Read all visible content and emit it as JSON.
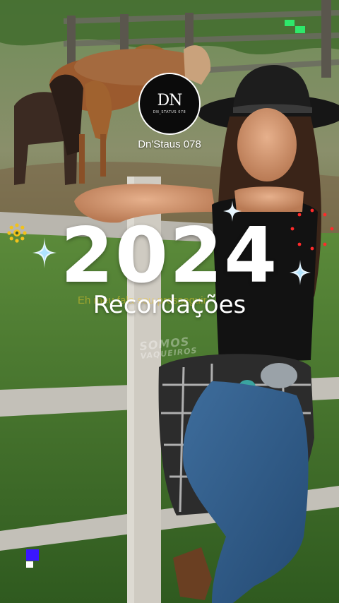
{
  "profile": {
    "avatar_monogram": "DN",
    "avatar_caption": "DN_STATUS 078",
    "username": "Dn'Staus 078"
  },
  "main": {
    "year": "2024",
    "subtitle": "Recordações",
    "ghost_text": "Eh meu fala seu prosseguir"
  },
  "watermark": {
    "line1": "SOMOS",
    "line2": "VAQUEIROS"
  },
  "icons": {
    "gear": "gear-icon",
    "sparkle": "sparkle-icon",
    "dotted_ring": "dotted-ring-icon"
  },
  "colors": {
    "sparkle": "#e8f6ff",
    "gear": "#f2c21a",
    "ring": "#ff2a2a",
    "pixel_green": "#2ee86b",
    "pixel_blue": "#3a16ff"
  }
}
